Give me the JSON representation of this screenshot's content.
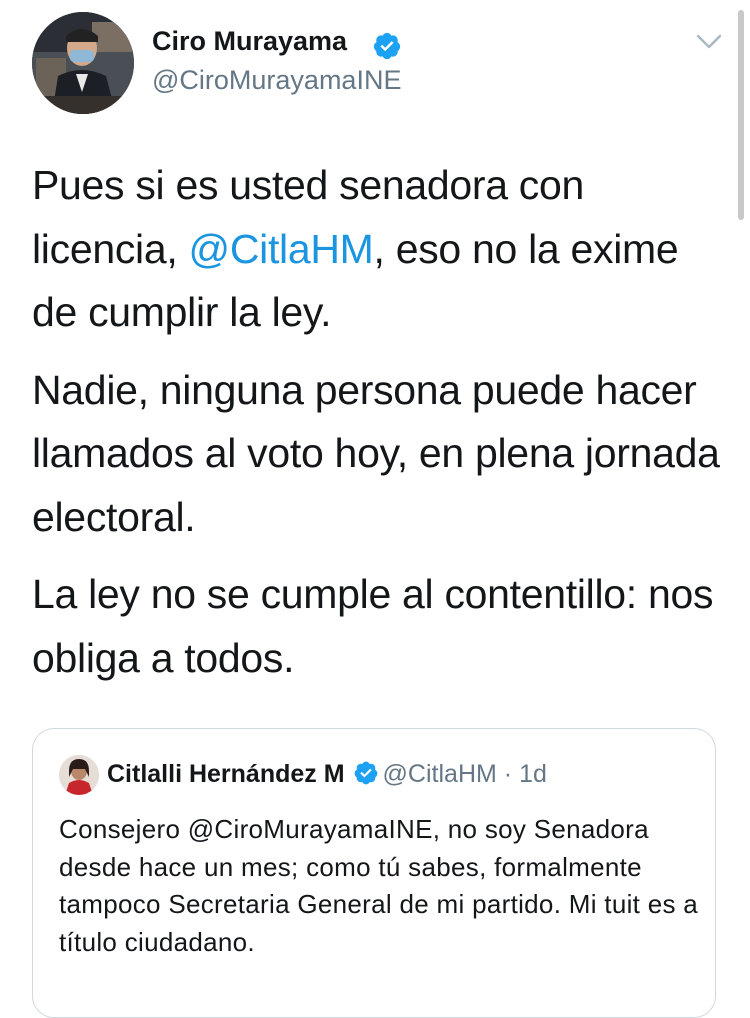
{
  "author": {
    "display_name": "Ciro Murayama",
    "handle": "@CiroMurayamaINE",
    "avatar_icon": "profile-photo",
    "verified_icon": "verified-badge-icon"
  },
  "tweet": {
    "p1_before": "Pues si es usted senadora con licencia, ",
    "p1_mention": "@CitlaHM",
    "p1_after": ", eso no la exime de cumplir la ley.",
    "p2": "Nadie, ninguna persona puede hacer llamados al voto hoy, en plena jornada electoral.",
    "p3": "La ley no se cumple al contentillo: nos obliga a todos."
  },
  "quoted": {
    "display_name": "Citlalli Hernández M",
    "handle": "@CitlaHM",
    "separator": "·",
    "time": "1d",
    "text": "Consejero @CiroMurayamaINE, no soy Senadora desde hace un mes; como tú sabes, formalmente tampoco Secretaria General de mi partido. Mi tuit es a título ciudadano."
  },
  "colors": {
    "link": "#1b95e0",
    "verified": "#1da1f2",
    "secondary_text": "#657786",
    "primary_text": "#14171a",
    "border": "#cfd9de"
  },
  "icons": {
    "menu": "chevron-down-icon",
    "verified": "verified-badge-icon"
  }
}
